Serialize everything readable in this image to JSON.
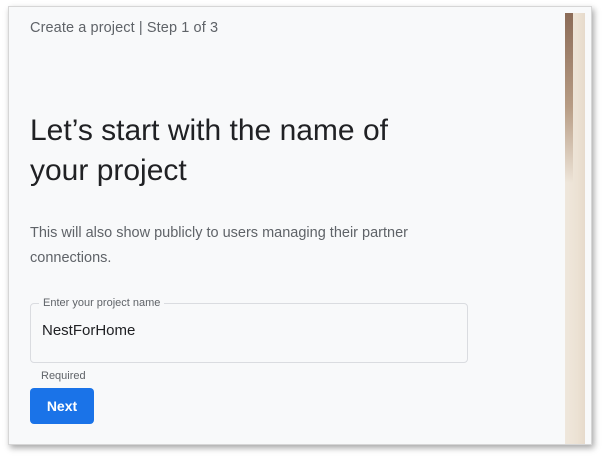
{
  "header": {
    "step_label": "Create a project | Step 1 of 3"
  },
  "main": {
    "heading": "Let’s start with the name of your project",
    "description": "This will also show publicly to users managing their partner connections."
  },
  "form": {
    "project_name": {
      "label": "Enter your project name",
      "value": "NestForHome",
      "helper": "Required"
    },
    "next_label": "Next"
  },
  "colors": {
    "primary": "#1a73e8",
    "heading_text": "#202124",
    "secondary_text": "#5f6368",
    "background": "#f8f9fa"
  }
}
